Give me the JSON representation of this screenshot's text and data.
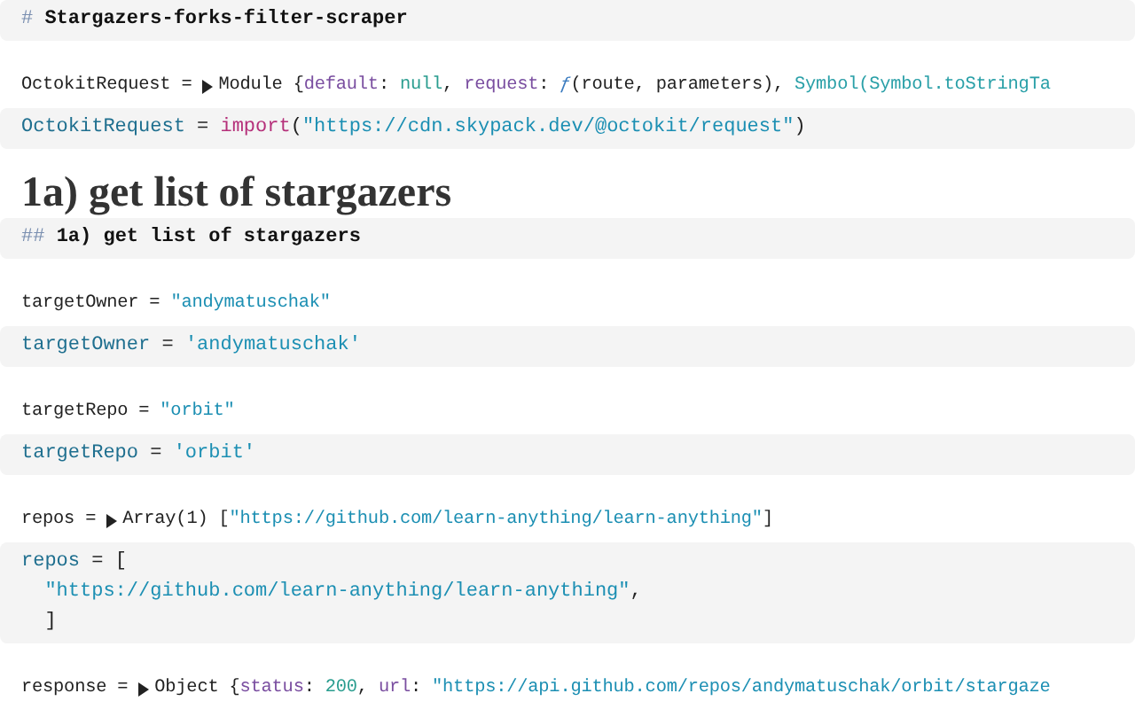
{
  "cells": [
    {
      "source": [
        [
          {
            "kind": "comment",
            "text": "# "
          },
          {
            "kind": "bold",
            "text": "Stargazers-forks-filter-scraper"
          }
        ]
      ]
    },
    {
      "output": {
        "name": "OctokitRequest =",
        "expandable": true,
        "value": [
          {
            "kind": "plain",
            "text": "Module {"
          },
          {
            "kind": "prop",
            "text": "default"
          },
          {
            "kind": "plain",
            "text": ": "
          },
          {
            "kind": "null",
            "text": "null"
          },
          {
            "kind": "plain",
            "text": ", "
          },
          {
            "kind": "prop",
            "text": "request"
          },
          {
            "kind": "plain",
            "text": ": "
          },
          {
            "kind": "fn",
            "text": "ƒ"
          },
          {
            "kind": "plain",
            "text": "(route, parameters), "
          },
          {
            "kind": "symbol",
            "text": "Symbol(Symbol.toStringTa"
          }
        ]
      },
      "source": [
        [
          {
            "kind": "var",
            "text": "OctokitRequest"
          },
          {
            "kind": "plain",
            "text": " = "
          },
          {
            "kind": "keyword",
            "text": "import"
          },
          {
            "kind": "plain",
            "text": "("
          },
          {
            "kind": "string",
            "text": "\"https://cdn.skypack.dev/@octokit/request\""
          },
          {
            "kind": "plain",
            "text": ")"
          }
        ]
      ]
    },
    {
      "heading": "1a) get list of stargazers",
      "source": [
        [
          {
            "kind": "comment",
            "text": "## "
          },
          {
            "kind": "bold",
            "text": "1a) get list of stargazers"
          }
        ]
      ]
    },
    {
      "output": {
        "name": "targetOwner =",
        "expandable": false,
        "value": [
          {
            "kind": "string",
            "text": "\"andymatuschak\""
          }
        ]
      },
      "source": [
        [
          {
            "kind": "var",
            "text": "targetOwner"
          },
          {
            "kind": "plain",
            "text": " = "
          },
          {
            "kind": "string",
            "text": "'andymatuschak'"
          }
        ]
      ]
    },
    {
      "output": {
        "name": "targetRepo =",
        "expandable": false,
        "value": [
          {
            "kind": "string",
            "text": "\"orbit\""
          }
        ]
      },
      "source": [
        [
          {
            "kind": "var",
            "text": "targetRepo"
          },
          {
            "kind": "plain",
            "text": " = "
          },
          {
            "kind": "string",
            "text": "'orbit'"
          }
        ]
      ]
    },
    {
      "output": {
        "name": "repos =",
        "expandable": true,
        "value": [
          {
            "kind": "plain",
            "text": "Array(1) ["
          },
          {
            "kind": "string",
            "text": "\"https://github.com/learn-anything/learn-anything\""
          },
          {
            "kind": "plain",
            "text": "]"
          }
        ]
      },
      "source": [
        [
          {
            "kind": "var",
            "text": "repos"
          },
          {
            "kind": "plain",
            "text": " = ["
          }
        ],
        [
          {
            "kind": "string",
            "text": "  \"https://github.com/learn-anything/learn-anything\""
          },
          {
            "kind": "plain",
            "text": ","
          }
        ],
        [
          {
            "kind": "plain",
            "text": "  ]"
          }
        ]
      ]
    },
    {
      "output": {
        "name": "response =",
        "expandable": true,
        "value": [
          {
            "kind": "plain",
            "text": "Object {"
          },
          {
            "kind": "prop",
            "text": "status"
          },
          {
            "kind": "plain",
            "text": ": "
          },
          {
            "kind": "number",
            "text": "200"
          },
          {
            "kind": "plain",
            "text": ", "
          },
          {
            "kind": "prop",
            "text": "url"
          },
          {
            "kind": "plain",
            "text": ": "
          },
          {
            "kind": "string",
            "text": "\"https://api.github.com/repos/andymatuschak/orbit/stargaze"
          }
        ]
      }
    }
  ]
}
